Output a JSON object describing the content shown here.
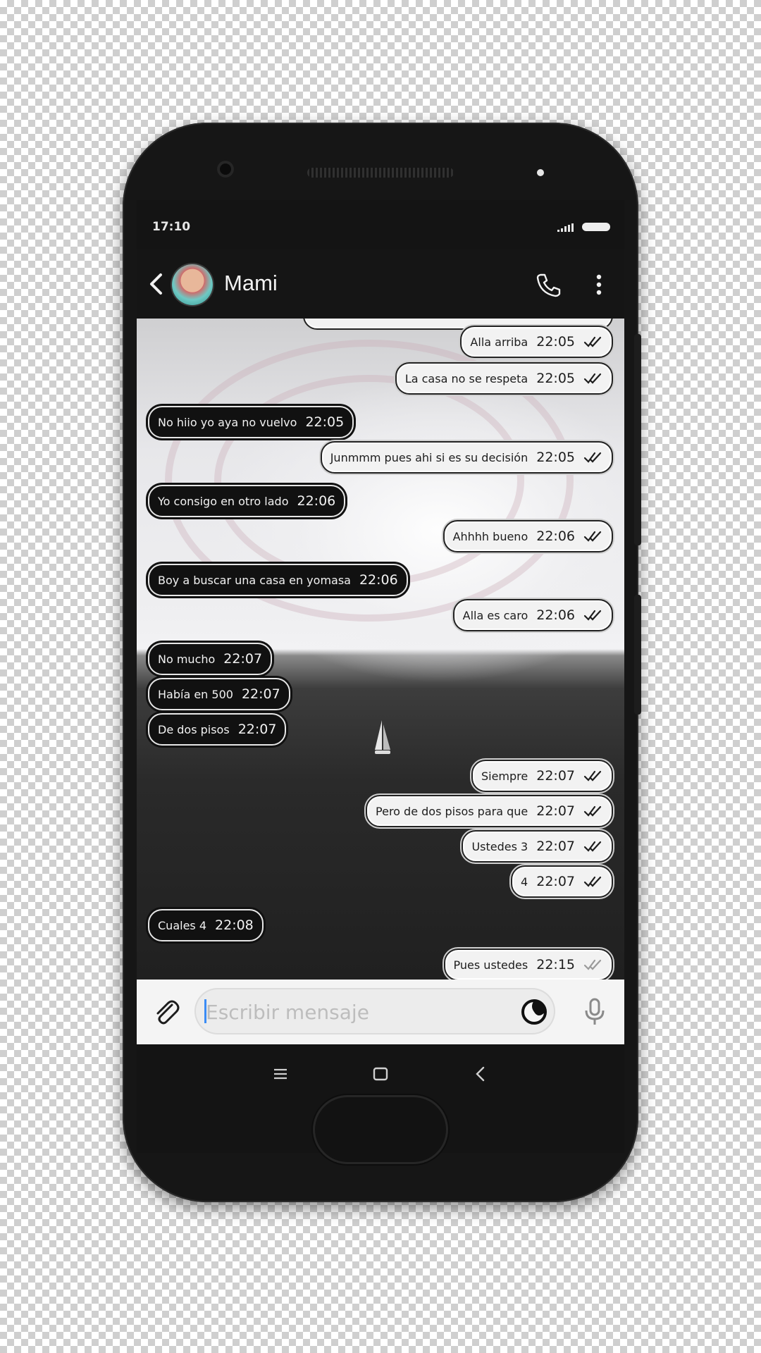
{
  "status_bar": {
    "time": "17:10"
  },
  "header": {
    "contact_name": "Mami"
  },
  "messages": [
    {
      "dir": "out",
      "text": "Alla arriba",
      "time": "22:05",
      "ticks": "read"
    },
    {
      "dir": "out",
      "text": "La casa no se respeta",
      "time": "22:05",
      "ticks": "read"
    },
    {
      "dir": "in",
      "text": "No hiio yo aya no vuelvo",
      "time": "22:05"
    },
    {
      "dir": "out",
      "text": "Junmmm pues ahi si es su decisión",
      "time": "22:05",
      "ticks": "read"
    },
    {
      "dir": "in",
      "text": "Yo consigo en otro lado",
      "time": "22:06"
    },
    {
      "dir": "out",
      "text": "Ahhhh bueno",
      "time": "22:06",
      "ticks": "read"
    },
    {
      "dir": "in",
      "text": "Boy a buscar una casa en yomasa",
      "time": "22:06"
    },
    {
      "dir": "out",
      "text": "Alla es caro",
      "time": "22:06",
      "ticks": "read"
    },
    {
      "dir": "in",
      "text": "No mucho",
      "time": "22:07"
    },
    {
      "dir": "in",
      "text": "Había en 500",
      "time": "22:07"
    },
    {
      "dir": "in",
      "text": "De dos pisos",
      "time": "22:07"
    },
    {
      "dir": "out",
      "text": "Siempre",
      "time": "22:07",
      "ticks": "read"
    },
    {
      "dir": "out",
      "text": "Pero de dos pisos para que",
      "time": "22:07",
      "ticks": "read"
    },
    {
      "dir": "out",
      "text": "Ustedes 3",
      "time": "22:07",
      "ticks": "read"
    },
    {
      "dir": "out",
      "text": "4",
      "time": "22:07",
      "ticks": "read"
    },
    {
      "dir": "in",
      "text": "Cuales 4",
      "time": "22:08"
    },
    {
      "dir": "out",
      "text": "Pues ustedes",
      "time": "22:15",
      "ticks": "delivered"
    }
  ],
  "composer": {
    "placeholder": "Escribir mensaje",
    "value": ""
  },
  "icons": {
    "back": "chevron-left-icon",
    "call": "phone-icon",
    "menu": "more-vert-icon",
    "attach": "paperclip-icon",
    "emoji": "sticker-icon",
    "mic": "microphone-icon",
    "nav_menu": "menu-icon",
    "nav_home": "square-icon",
    "nav_back": "back-icon"
  },
  "colors": {
    "bubble_out": "#f2f2f2",
    "bubble_in": "#111111",
    "tick_read": "#1d1d1d",
    "tick_delivered": "#9a9a9a",
    "caret": "#3b8cf5"
  }
}
